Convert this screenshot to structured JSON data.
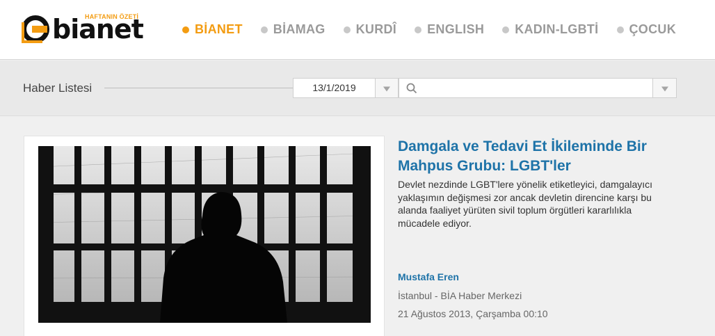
{
  "brand": {
    "wordmark": "bianet",
    "tagline": "HAFTANIN ÖZETİ",
    "accent_color": "#f39c12"
  },
  "nav": {
    "items": [
      {
        "label": "BİANET",
        "active": true
      },
      {
        "label": "BİAMAG",
        "active": false
      },
      {
        "label": "KURDÎ",
        "active": false
      },
      {
        "label": "ENGLISH",
        "active": false
      },
      {
        "label": "KADIN-LGBTİ",
        "active": false
      },
      {
        "label": "ÇOCUK",
        "active": false
      }
    ]
  },
  "filter": {
    "title": "Haber Listesi",
    "date_value": "13/1/2019",
    "search_placeholder": "",
    "icons": {
      "date_dropdown": "triangle-down-icon",
      "search": "search-icon",
      "search_dropdown": "triangle-down-icon"
    }
  },
  "article": {
    "headline": "Damgala ve Tedavi Et İkileminde Bir Mahpus Grubu: LGBT'ler",
    "summary": "Devlet nezdinde LGBT'lere yönelik etiketleyici, damgalayıcı yaklaşımın değişmesi zor ancak devletin direncine karşı bu alanda faaliyet yürüten sivil toplum örgütleri kararlılıkla mücadele ediyor.",
    "author": "Mustafa Eren",
    "source": "İstanbul - BİA Haber Merkezi",
    "date": "21 Ağustos 2013, Çarşamba 00:10",
    "headline_color": "#1e73a8"
  }
}
